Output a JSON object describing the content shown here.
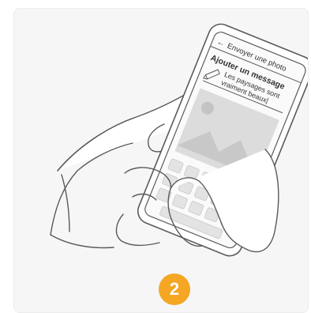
{
  "illustration": {
    "screen_title": "Envoyer une photo",
    "back_arrow": "←",
    "heading": "Ajouter un message",
    "message_line1": "Les paysages sont",
    "message_line2": "vraiment beaux|",
    "icons": {
      "back": "arrow-left-icon",
      "edit": "pencil-icon",
      "photo": "image-placeholder-icon"
    }
  },
  "step": {
    "number": "2",
    "color": "#f5a623"
  }
}
